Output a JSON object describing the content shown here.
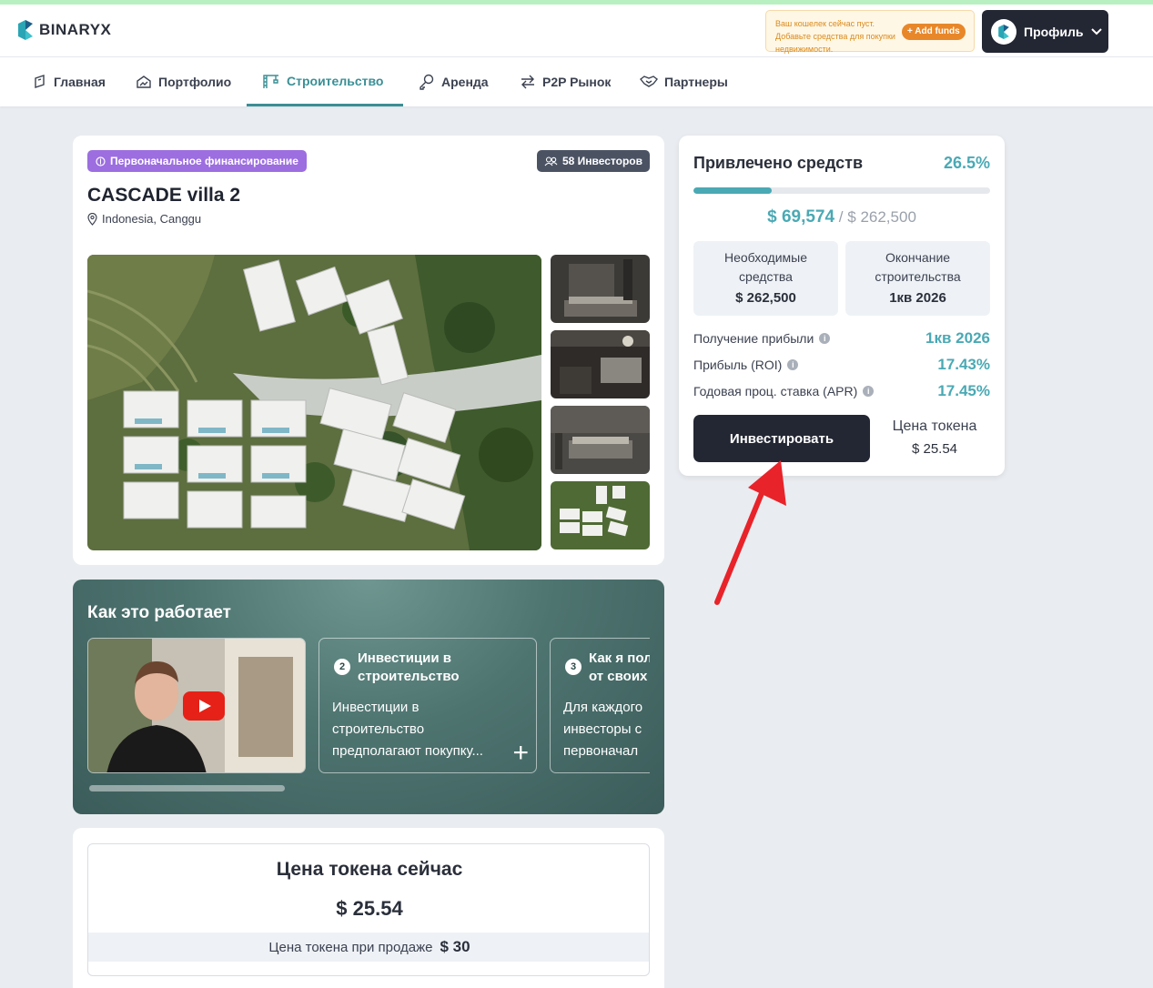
{
  "brand": {
    "name": "BINARYX"
  },
  "wallet": {
    "message": "Ваш кошелек сейчас пуст. Добавьте средства для покупки недвижимости.",
    "add_funds": "Add funds"
  },
  "profile": {
    "label": "Профиль"
  },
  "nav": {
    "items": [
      {
        "label": "Главная",
        "icon": "home-icon"
      },
      {
        "label": "Портфолио",
        "icon": "portfolio-icon"
      },
      {
        "label": "Строительство",
        "icon": "construction-icon",
        "active": true
      },
      {
        "label": "Аренда",
        "icon": "key-icon"
      },
      {
        "label": "P2P Рынок",
        "icon": "swap-icon"
      },
      {
        "label": "Партнеры",
        "icon": "handshake-icon"
      }
    ]
  },
  "property": {
    "stage_badge": "Первоначальное финансирование",
    "investors_badge": "58 Инвесторов",
    "title": "CASCADE villa 2",
    "location": "Indonesia, Canggu"
  },
  "how": {
    "title": "Как это работает",
    "steps": [
      {
        "num": "2",
        "title": "Инвестиции в строительство",
        "text": "Инвестиции в строительство предполагают покупку..."
      },
      {
        "num": "3",
        "title": "Как я пол от своих",
        "text": "Для каждого инвесторы с первоначал"
      }
    ]
  },
  "token_price": {
    "title": "Цена токена сейчас",
    "value": "$ 25.54",
    "sell_label": "Цена токена при продаже",
    "sell_value": "$ 30"
  },
  "funding": {
    "title": "Привлечено средств",
    "percent": "26.5%",
    "progress": 0.265,
    "raised": "$ 69,574",
    "separator": "/",
    "goal": "$ 262,500",
    "required_label": "Необходимые средства",
    "required_value": "$ 262,500",
    "end_label": "Окончание строительства",
    "end_value": "1кв 2026",
    "profit_date_label": "Получение прибыли",
    "profit_date_value": "1кв 2026",
    "roi_label": "Прибыль (ROI)",
    "roi_value": "17.43%",
    "apr_label": "Годовая проц. ставка (APR)",
    "apr_value": "17.45%",
    "invest_button": "Инвестировать",
    "token_label": "Цена токена",
    "token_value": "$ 25.54"
  },
  "colors": {
    "accent": "#4aa9b4",
    "dark": "#232733",
    "purple": "#9c6ee0",
    "arrow": "#e8232a"
  }
}
